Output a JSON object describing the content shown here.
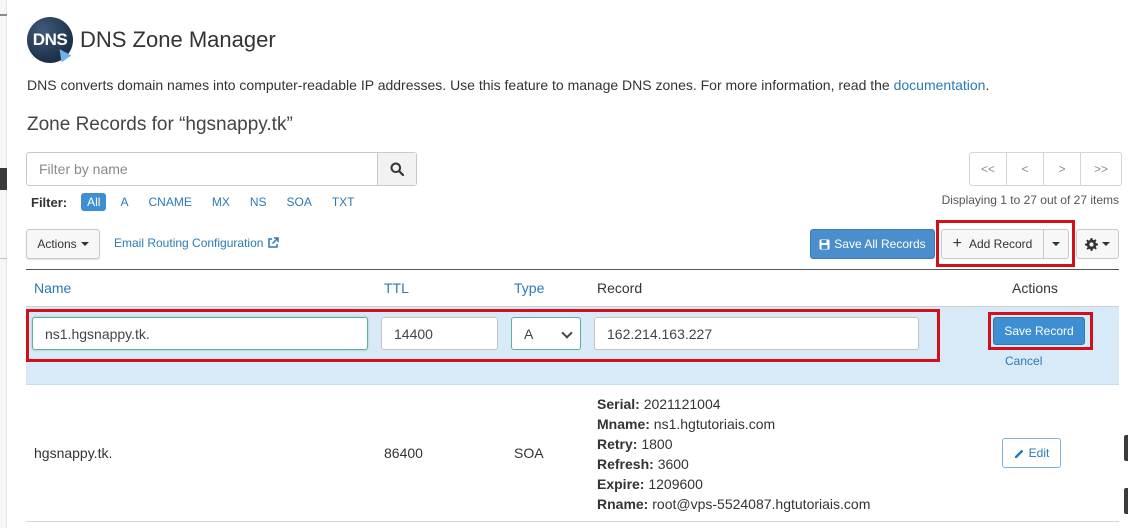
{
  "app": {
    "logo_text": "DNS",
    "title": "DNS Zone Manager"
  },
  "intro": {
    "text": "DNS converts domain names into computer-readable IP addresses. Use this feature to manage DNS zones. For more information, read the ",
    "link": "documentation",
    "suffix": "."
  },
  "zone": {
    "heading": "Zone Records for “hgsnappy.tk”"
  },
  "search": {
    "placeholder": "Filter by name"
  },
  "filter": {
    "label": "Filter:",
    "chips": [
      "All",
      "A",
      "CNAME",
      "MX",
      "NS",
      "SOA",
      "TXT"
    ],
    "active": "All"
  },
  "pager": {
    "first": "<<",
    "prev": "<",
    "next": ">",
    "last": ">>",
    "status": "Displaying 1 to 27 out of 27 items"
  },
  "toolbar": {
    "actions_label": "Actions",
    "email_routing_label": "Email Routing Configuration",
    "save_all_label": "Save All Records",
    "add_record_label": "Add Record"
  },
  "table": {
    "headers": {
      "name": "Name",
      "ttl": "TTL",
      "type": "Type",
      "record": "Record",
      "actions": "Actions"
    },
    "new_row": {
      "name": "ns1.hgsnappy.tk.",
      "ttl": "14400",
      "type": "A",
      "record": "162.214.163.227",
      "save_label": "Save Record",
      "cancel_label": "Cancel"
    },
    "soa_row": {
      "name": "hgsnappy.tk.",
      "ttl": "86400",
      "type": "SOA",
      "details": {
        "serial_label": "Serial:",
        "serial": "2021121004",
        "mname_label": "Mname:",
        "mname": "ns1.hgtutoriais.com",
        "retry_label": "Retry:",
        "retry": "1800",
        "refresh_label": "Refresh:",
        "refresh": "3600",
        "expire_label": "Expire:",
        "expire": "1209600",
        "rname_label": "Rname:",
        "rname": "root@vps-5524087.hgtutoriais.com"
      },
      "edit_label": "Edit"
    }
  },
  "colors": {
    "link": "#2a7ab6",
    "primary": "#3d8fd1",
    "highlight": "#d0101a",
    "edit_row_bg": "#d8eaf7"
  }
}
